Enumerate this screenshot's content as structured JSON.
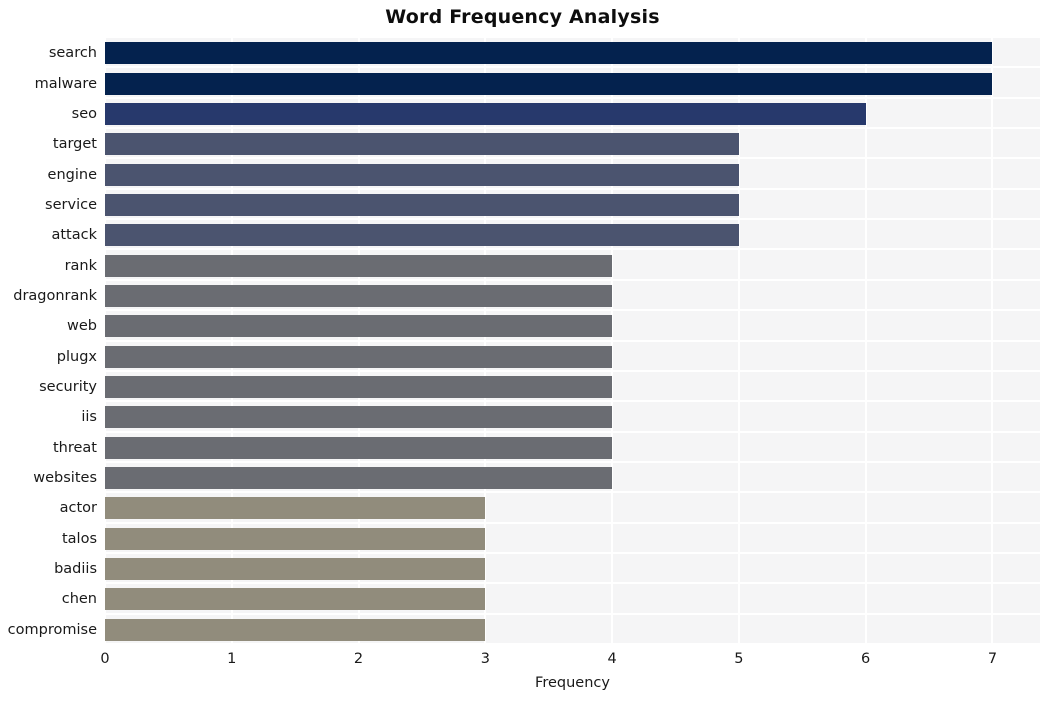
{
  "chart_data": {
    "type": "bar",
    "orientation": "horizontal",
    "title": "Word Frequency Analysis",
    "xlabel": "Frequency",
    "ylabel": "",
    "categories": [
      "search",
      "malware",
      "seo",
      "target",
      "engine",
      "service",
      "attack",
      "rank",
      "dragonrank",
      "web",
      "plugx",
      "security",
      "iis",
      "threat",
      "websites",
      "actor",
      "talos",
      "badiis",
      "chen",
      "compromise"
    ],
    "values": [
      7,
      7,
      6,
      5,
      5,
      5,
      5,
      4,
      4,
      4,
      4,
      4,
      4,
      4,
      4,
      3,
      3,
      3,
      3,
      3
    ],
    "bar_colors": [
      "#04224e",
      "#04224e",
      "#27396c",
      "#4b546f",
      "#4b546f",
      "#4b546f",
      "#4b546f",
      "#6a6c72",
      "#6a6c72",
      "#6a6c72",
      "#6a6c72",
      "#6a6c72",
      "#6a6c72",
      "#6a6c72",
      "#6a6c72",
      "#918c7c",
      "#918c7c",
      "#918c7c",
      "#918c7c",
      "#918c7c"
    ],
    "xlim": [
      0,
      7.375
    ],
    "xticks": [
      0,
      1,
      2,
      3,
      4,
      5,
      6,
      7
    ],
    "xtick_labels": [
      "0",
      "1",
      "2",
      "3",
      "4",
      "5",
      "6",
      "7"
    ],
    "grid": true,
    "grid_axis": "x",
    "legend": null,
    "plot_background": "#f5f5f6",
    "figure_background": "#ffffff",
    "gridline_color": "#ffffff"
  }
}
